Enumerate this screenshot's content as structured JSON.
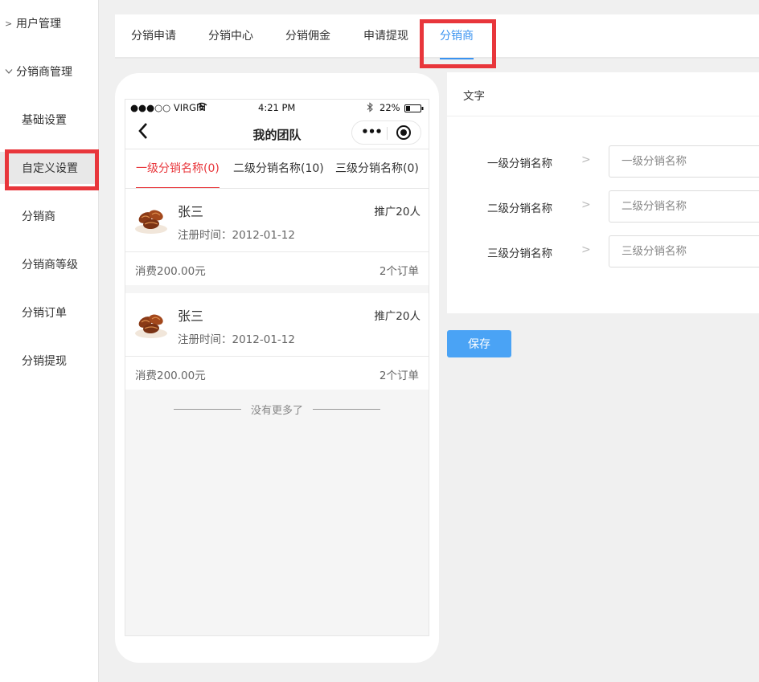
{
  "sidebar": {
    "items": [
      {
        "label": "用户管理",
        "kind": "group",
        "expanded": false,
        "icon": "chevron-right-icon"
      },
      {
        "label": "分销商管理",
        "kind": "group",
        "expanded": true,
        "icon": "chevron-down-icon"
      },
      {
        "label": "基础设置",
        "kind": "sub"
      },
      {
        "label": "自定义设置",
        "kind": "sub",
        "active": true
      },
      {
        "label": "分销商",
        "kind": "sub"
      },
      {
        "label": "分销商等级",
        "kind": "sub"
      },
      {
        "label": "分销订单",
        "kind": "sub"
      },
      {
        "label": "分销提现",
        "kind": "sub"
      }
    ]
  },
  "tabs": [
    {
      "label": "分销申请"
    },
    {
      "label": "分销中心"
    },
    {
      "label": "分销佣金"
    },
    {
      "label": "申请提现"
    },
    {
      "label": "分销商",
      "active": true
    }
  ],
  "phone": {
    "status": {
      "carrier": "●●●○○ VIRGIN",
      "time": "4:21 PM",
      "battery": "22%"
    },
    "nav_title": "我的团队",
    "tabs": [
      {
        "label": "一级分销名称(0)",
        "active": true
      },
      {
        "label": "二级分销名称(10)"
      },
      {
        "label": "三级分销名称(0)"
      }
    ],
    "members": [
      {
        "name": "张三",
        "register": "注册时间：2012-01-12",
        "promoted": "推广20人",
        "spend": "消费200.00元",
        "orders": "2个订单",
        "avatar": "pecan-nuts-image"
      },
      {
        "name": "张三",
        "register": "注册时间：2012-01-12",
        "promoted": "推广20人",
        "spend": "消费200.00元",
        "orders": "2个订单",
        "avatar": "pecan-nuts-image"
      }
    ],
    "no_more": "没有更多了"
  },
  "panel": {
    "title": "文字",
    "fields": [
      {
        "label": "一级分销名称",
        "placeholder": "一级分销名称"
      },
      {
        "label": "二级分销名称",
        "placeholder": "二级分销名称"
      },
      {
        "label": "三级分销名称",
        "placeholder": "三级分销名称"
      }
    ]
  },
  "save_label": "保存",
  "colors": {
    "accent": "#3a93f0",
    "highlight": "#e8363b",
    "button": "#4aa3f5"
  }
}
